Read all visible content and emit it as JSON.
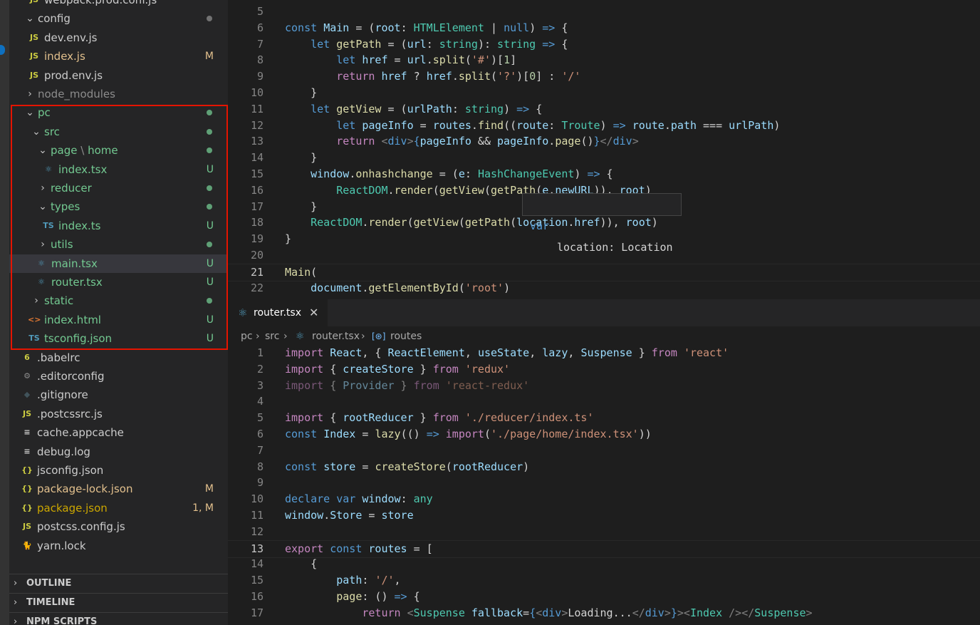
{
  "explorer": {
    "rows": [
      {
        "label": "webpack.prod.conf.js",
        "icon": "JS",
        "icon_name": "js-file-icon",
        "color": "#cccccc",
        "indent": 40,
        "chevron": "",
        "badge": "",
        "dot": ""
      },
      {
        "label": "config",
        "icon": "",
        "icon_name": "",
        "color": "#cccccc",
        "indent": 22,
        "chevron": "v",
        "badge": "",
        "dot": "grey"
      },
      {
        "label": "dev.env.js",
        "icon": "JS",
        "icon_name": "js-file-icon",
        "color": "#cccccc",
        "indent": 40,
        "chevron": "",
        "badge": "",
        "dot": ""
      },
      {
        "label": "index.js",
        "icon": "JS",
        "icon_name": "js-file-icon",
        "color": "#e2c08d",
        "indent": 40,
        "chevron": "",
        "badge": "M",
        "dot": ""
      },
      {
        "label": "prod.env.js",
        "icon": "JS",
        "icon_name": "js-file-icon",
        "color": "#cccccc",
        "indent": 40,
        "chevron": "",
        "badge": "",
        "dot": ""
      },
      {
        "label": "node_modules",
        "icon": "",
        "icon_name": "",
        "color": "#8c8c8c",
        "indent": 22,
        "chevron": ">",
        "badge": "",
        "dot": ""
      },
      {
        "label": "pc",
        "icon": "",
        "icon_name": "",
        "color": "#73c991",
        "indent": 22,
        "chevron": "v",
        "badge": "",
        "dot": "green"
      },
      {
        "label": "src",
        "icon": "",
        "icon_name": "",
        "color": "#73c991",
        "indent": 31,
        "chevron": "v",
        "badge": "",
        "dot": "green"
      },
      {
        "label": "page",
        "label2": "home",
        "icon": "",
        "icon_name": "",
        "color": "#73c991",
        "indent": 40,
        "chevron": "v",
        "badge": "",
        "dot": "green"
      },
      {
        "label": "index.tsx",
        "icon": "⚛",
        "icon_name": "react-file-icon",
        "color": "#73c991",
        "indent": 60,
        "chevron": "",
        "badge": "U",
        "dot": ""
      },
      {
        "label": "reducer",
        "icon": "",
        "icon_name": "",
        "color": "#73c991",
        "indent": 40,
        "chevron": ">",
        "badge": "",
        "dot": "green"
      },
      {
        "label": "types",
        "icon": "",
        "icon_name": "",
        "color": "#73c991",
        "indent": 40,
        "chevron": "v",
        "badge": "",
        "dot": "green"
      },
      {
        "label": "index.ts",
        "icon": "TS",
        "icon_name": "ts-file-icon",
        "color": "#73c991",
        "indent": 60,
        "chevron": "",
        "badge": "U",
        "dot": ""
      },
      {
        "label": "utils",
        "icon": "",
        "icon_name": "",
        "color": "#73c991",
        "indent": 40,
        "chevron": ">",
        "badge": "",
        "dot": "green"
      },
      {
        "label": "main.tsx",
        "icon": "⚛",
        "icon_name": "react-file-icon",
        "color": "#73c991",
        "indent": 50,
        "chevron": "",
        "badge": "U",
        "dot": "",
        "selected": true
      },
      {
        "label": "router.tsx",
        "icon": "⚛",
        "icon_name": "react-file-icon",
        "color": "#73c991",
        "indent": 50,
        "chevron": "",
        "badge": "U",
        "dot": ""
      },
      {
        "label": "static",
        "icon": "",
        "icon_name": "",
        "color": "#73c991",
        "indent": 31,
        "chevron": ">",
        "badge": "",
        "dot": "green"
      },
      {
        "label": "index.html",
        "icon": "<>",
        "icon_name": "html-file-icon",
        "color": "#73c991",
        "indent": 40,
        "chevron": "",
        "badge": "U",
        "dot": ""
      },
      {
        "label": "tsconfig.json",
        "icon": "TS",
        "icon_name": "tsconfig-file-icon",
        "color": "#73c991",
        "indent": 40,
        "chevron": "",
        "badge": "U",
        "dot": ""
      },
      {
        "label": ".babelrc",
        "icon": "6",
        "icon_name": "babel-file-icon",
        "color": "#cccccc",
        "indent": 30,
        "chevron": "",
        "badge": "",
        "dot": ""
      },
      {
        "label": ".editorconfig",
        "icon": "⚙",
        "icon_name": "gear-icon",
        "color": "#cccccc",
        "indent": 30,
        "chevron": "",
        "badge": "",
        "dot": ""
      },
      {
        "label": ".gitignore",
        "icon": "◆",
        "icon_name": "git-file-icon",
        "color": "#cccccc",
        "indent": 30,
        "chevron": "",
        "badge": "",
        "dot": ""
      },
      {
        "label": ".postcssrc.js",
        "icon": "JS",
        "icon_name": "js-file-icon",
        "color": "#cccccc",
        "indent": 30,
        "chevron": "",
        "badge": "",
        "dot": ""
      },
      {
        "label": "cache.appcache",
        "icon": "≡",
        "icon_name": "text-file-icon",
        "color": "#cccccc",
        "indent": 30,
        "chevron": "",
        "badge": "",
        "dot": ""
      },
      {
        "label": "debug.log",
        "icon": "≡",
        "icon_name": "text-file-icon",
        "color": "#cccccc",
        "indent": 30,
        "chevron": "",
        "badge": "",
        "dot": ""
      },
      {
        "label": "jsconfig.json",
        "icon": "{}",
        "icon_name": "json-file-icon",
        "color": "#cccccc",
        "indent": 30,
        "chevron": "",
        "badge": "",
        "dot": ""
      },
      {
        "label": "package-lock.json",
        "icon": "{}",
        "icon_name": "json-file-icon",
        "color": "#e2c08d",
        "indent": 30,
        "chevron": "",
        "badge": "M",
        "dot": ""
      },
      {
        "label": "package.json",
        "icon": "{}",
        "icon_name": "json-file-icon",
        "color": "#cca700",
        "indent": 30,
        "chevron": "",
        "badge": "1, M",
        "dot": ""
      },
      {
        "label": "postcss.config.js",
        "icon": "JS",
        "icon_name": "js-file-icon",
        "color": "#cccccc",
        "indent": 30,
        "chevron": "",
        "badge": "",
        "dot": ""
      },
      {
        "label": "yarn.lock",
        "icon": "🐈",
        "icon_name": "yarn-file-icon",
        "color": "#cccccc",
        "indent": 30,
        "chevron": "",
        "badge": "",
        "dot": ""
      }
    ],
    "panels": [
      "OUTLINE",
      "TIMELINE",
      "NPM SCRIPTS"
    ]
  },
  "top_editor": {
    "lines": [
      {
        "n": "5",
        "html": ""
      },
      {
        "n": "6",
        "html": "<span class='k'>const</span> <span class='v'>Main</span> = (<span class='v'>root</span>: <span class='t'>HTMLElement</span> | <span class='k'>null</span>) <span class='k'>=&gt;</span> {"
      },
      {
        "n": "7",
        "html": "    <span class='k'>let</span> <span class='f'>getPath</span> = (<span class='v'>url</span>: <span class='t'>string</span>): <span class='t'>string</span> <span class='k'>=&gt;</span> {"
      },
      {
        "n": "8",
        "html": "        <span class='k'>let</span> <span class='v'>href</span> = <span class='v'>url</span>.<span class='f'>split</span>(<span class='s'>'#'</span>)[<span class='n'>1</span>]"
      },
      {
        "n": "9",
        "html": "        <span class='c'>return</span> <span class='v'>href</span> ? <span class='v'>href</span>.<span class='f'>split</span>(<span class='s'>'?'</span>)[<span class='n'>0</span>] : <span class='s'>'/'</span>"
      },
      {
        "n": "10",
        "html": "    }"
      },
      {
        "n": "11",
        "html": "    <span class='k'>let</span> <span class='f'>getView</span> = (<span class='v'>urlPath</span>: <span class='t'>string</span>) <span class='k'>=&gt;</span> {"
      },
      {
        "n": "12",
        "html": "        <span class='k'>let</span> <span class='v'>pageInfo</span> = <span class='v'>routes</span>.<span class='f'>find</span>((<span class='v'>route</span>: <span class='t'>Troute</span>) <span class='k'>=&gt;</span> <span class='v'>route</span>.<span class='v'>path</span> === <span class='v'>urlPath</span>)"
      },
      {
        "n": "13",
        "html": "        <span class='c'>return</span> <span class='tg'>&lt;</span><span class='k'>div</span><span class='tg'>&gt;</span><span class='k'>{</span><span class='v'>pageInfo</span> &amp;&amp; <span class='v'>pageInfo</span>.<span class='f'>page</span>()<span class='k'>}</span><span class='tg'>&lt;/</span><span class='k'>div</span><span class='tg'>&gt;</span>"
      },
      {
        "n": "14",
        "html": "    }"
      },
      {
        "n": "15",
        "html": "    <span class='v'>window</span>.<span class='f'>onhashchange</span> = (<span class='v'>e</span>: <span class='t'>HashChangeEvent</span>) <span class='k'>=&gt;</span> {"
      },
      {
        "n": "16",
        "html": "        <span class='t'>ReactDOM</span>.<span class='f'>render</span>(<span class='f'>getView</span>(<span class='f'>getPath</span>(<span class='v'>e</span>.<span class='v'>newURL</span>)), <span class='v'>root</span>)"
      },
      {
        "n": "17",
        "html": "    }"
      },
      {
        "n": "18",
        "html": "    <span class='t'>ReactDOM</span>.<span class='f'>render</span>(<span class='f'>getView</span>(<span class='f'>getPath</span>(<span class='v'>location</span>.<span class='v'>href</span>)), <span class='v'>root</span>)"
      },
      {
        "n": "19",
        "html": "}"
      },
      {
        "n": "20",
        "html": ""
      },
      {
        "n": "21",
        "html": "<span class='f'>Main</span>("
      },
      {
        "n": "22",
        "html": "    <span class='v'>document</span>.<span class='f'>getElementById</span>(<span class='s'>'root'</span>)"
      }
    ],
    "hover": {
      "keyword": "var",
      "text": "location: Location"
    }
  },
  "tab": {
    "label": "router.tsx",
    "close": "✕"
  },
  "breadcrumbs": [
    "pc",
    "src",
    "router.tsx",
    "routes"
  ],
  "bottom_editor": {
    "lines": [
      {
        "n": "1",
        "html": "<span class='c'>import</span> <span class='v'>React</span>, { <span class='v'>ReactElement</span>, <span class='v'>useState</span>, <span class='v'>lazy</span>, <span class='v'>Suspense</span> } <span class='c'>from</span> <span class='s'>'react'</span>"
      },
      {
        "n": "2",
        "html": "<span class='c'>import</span> { <span class='v'>createStore</span> } <span class='c'>from</span> <span class='s'>'redux'</span>"
      },
      {
        "n": "3",
        "html": "<span class='dim'><span class='c'>import</span> { <span class='v'>Provider</span> } <span class='c'>from</span> <span class='s'>'react-redux'</span></span>"
      },
      {
        "n": "4",
        "html": ""
      },
      {
        "n": "5",
        "html": "<span class='c'>import</span> { <span class='v'>rootReducer</span> } <span class='c'>from</span> <span class='s'>'./reducer/index.ts'</span>"
      },
      {
        "n": "6",
        "html": "<span class='k'>const</span> <span class='v'>Index</span> = <span class='f'>lazy</span>(() <span class='k'>=&gt;</span> <span class='c'>import</span>(<span class='s'>'./page/home/index.tsx'</span>))"
      },
      {
        "n": "7",
        "html": ""
      },
      {
        "n": "8",
        "html": "<span class='k'>const</span> <span class='v'>store</span> = <span class='f'>createStore</span>(<span class='v'>rootReducer</span>)"
      },
      {
        "n": "9",
        "html": ""
      },
      {
        "n": "10",
        "html": "<span class='k'>declare</span> <span class='k'>var</span> <span class='v'>window</span>: <span class='t'>any</span>"
      },
      {
        "n": "11",
        "html": "<span class='v'>window</span>.<span class='v'>Store</span> = <span class='v'>store</span>"
      },
      {
        "n": "12",
        "html": ""
      },
      {
        "n": "13",
        "html": "<span class='c'>export</span> <span class='k'>const</span> <span class='v'>routes</span> = ["
      },
      {
        "n": "14",
        "html": "    {"
      },
      {
        "n": "15",
        "html": "        <span class='v'>path</span>: <span class='s'>'/'</span>,"
      },
      {
        "n": "16",
        "html": "        <span class='f'>page</span>: () <span class='k'>=&gt;</span> {"
      },
      {
        "n": "17",
        "html": "            <span class='c'>return</span> <span class='tg'>&lt;</span><span class='t'>Suspense</span> <span class='v'>fallback</span>=<span class='k'>{</span><span class='tg'>&lt;</span><span class='k'>div</span><span class='tg'>&gt;</span>Loading...<span class='tg'>&lt;/</span><span class='k'>div</span><span class='tg'>&gt;</span><span class='k'>}</span><span class='tg'>&gt;&lt;</span><span class='t'>Index</span> <span class='tg'>/&gt;&lt;/</span><span class='t'>Suspense</span><span class='tg'>&gt;</span>"
      }
    ]
  }
}
